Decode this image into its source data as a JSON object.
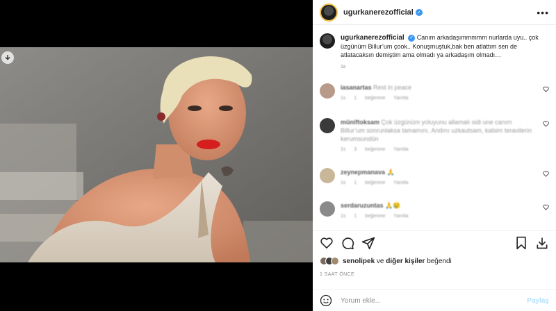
{
  "post": {
    "username": "ugurkanerezofficial",
    "caption": "Canım arkadaşımmmmm nurlarda uyu.. çok üzgünüm Billur’um çook.. Konuşmuştuk,bak ben atlattım sen de atlatacaksın demiştim ama olmadı ya arkadaşım olmadı…",
    "caption_time": "1s"
  },
  "comments": [
    {
      "username": "iasanartas",
      "text": "Rest in peace",
      "meta": "1s  1 beğenme  Yanıtla",
      "avatar_color": "#b89a8a"
    },
    {
      "username": "müniftoksam",
      "text": "Çok üzgünüm yoluyunu allamalı sidi une canım Billur’um sonrunlaksa tamamını. Andırıı uzkautsam, kalsim teravilerin kerumsundün",
      "meta": "1s  3 beğenme  Yanıtla",
      "avatar_color": "#3a3a3a"
    },
    {
      "username": "zeynepmanava",
      "text": "",
      "meta": "1s  1 beğenme  Yanıtla",
      "avatar_color": "#c9b79a"
    },
    {
      "username": "serdaruzuntas",
      "text": "",
      "meta": "1s  1 beğenme  Yanıtla",
      "avatar_color": "#8a8a8a"
    }
  ],
  "likes": {
    "first_user": "senolipek",
    "connector": "ve",
    "others": "diğer kişiler",
    "suffix": "beğendi"
  },
  "timestamp": "1 SAAT ÖNCE",
  "comment_box": {
    "placeholder": "Yorum ekle...",
    "post_label": "Paylaş"
  },
  "colors": {
    "verified": "#3897f0",
    "post_button_disabled": "#b2dffc",
    "muted_text": "#8e8e8e"
  },
  "icons": [
    "more-options-icon",
    "verified-icon",
    "heart-icon",
    "comment-icon",
    "share-icon",
    "save-icon",
    "download-icon",
    "emoji-icon"
  ]
}
